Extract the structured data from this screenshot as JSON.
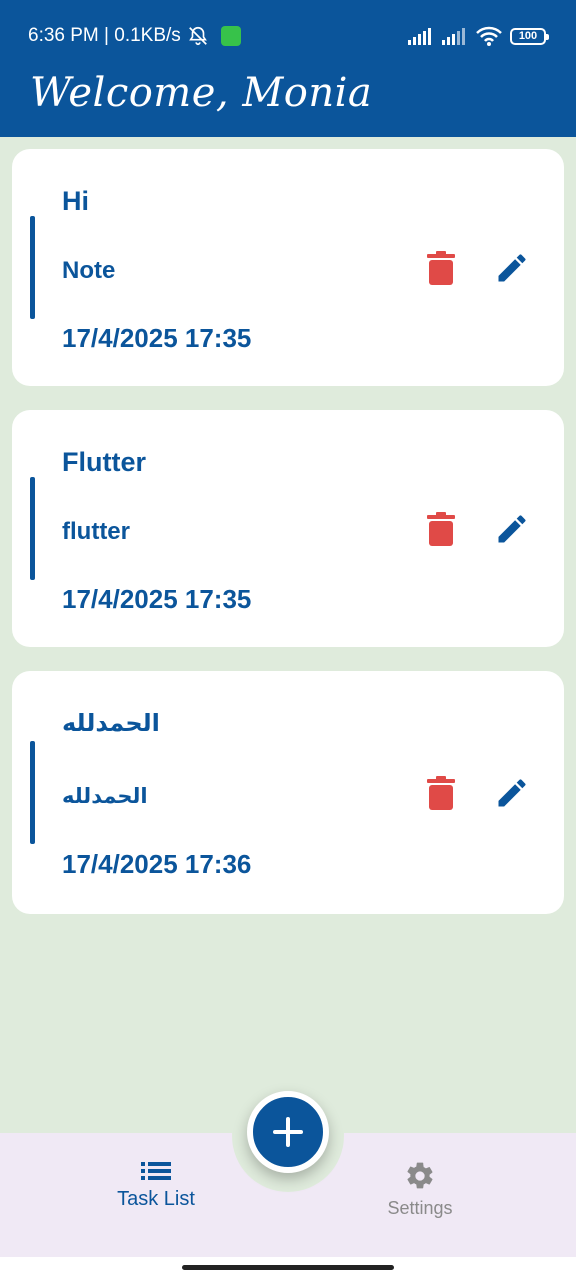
{
  "status_bar": {
    "time_speed": "6:36 PM | 0.1KB/s",
    "battery": "100"
  },
  "header": {
    "welcome": "Welcome, Monia"
  },
  "tasks": [
    {
      "title": "Hi",
      "note": "Note",
      "date": "17/4/2025 17:35"
    },
    {
      "title": "Flutter",
      "note": "flutter",
      "date": "17/4/2025 17:35"
    },
    {
      "title": "الحمدلله",
      "note": "الحمدلله",
      "date": "17/4/2025 17:36"
    }
  ],
  "bottom_nav": {
    "task_list_label": "Task List",
    "settings_label": "Settings"
  },
  "colors": {
    "primary": "#0b559b",
    "delete": "#e04a47",
    "background": "#dfebdc",
    "nav_background": "#f0e9f5"
  }
}
